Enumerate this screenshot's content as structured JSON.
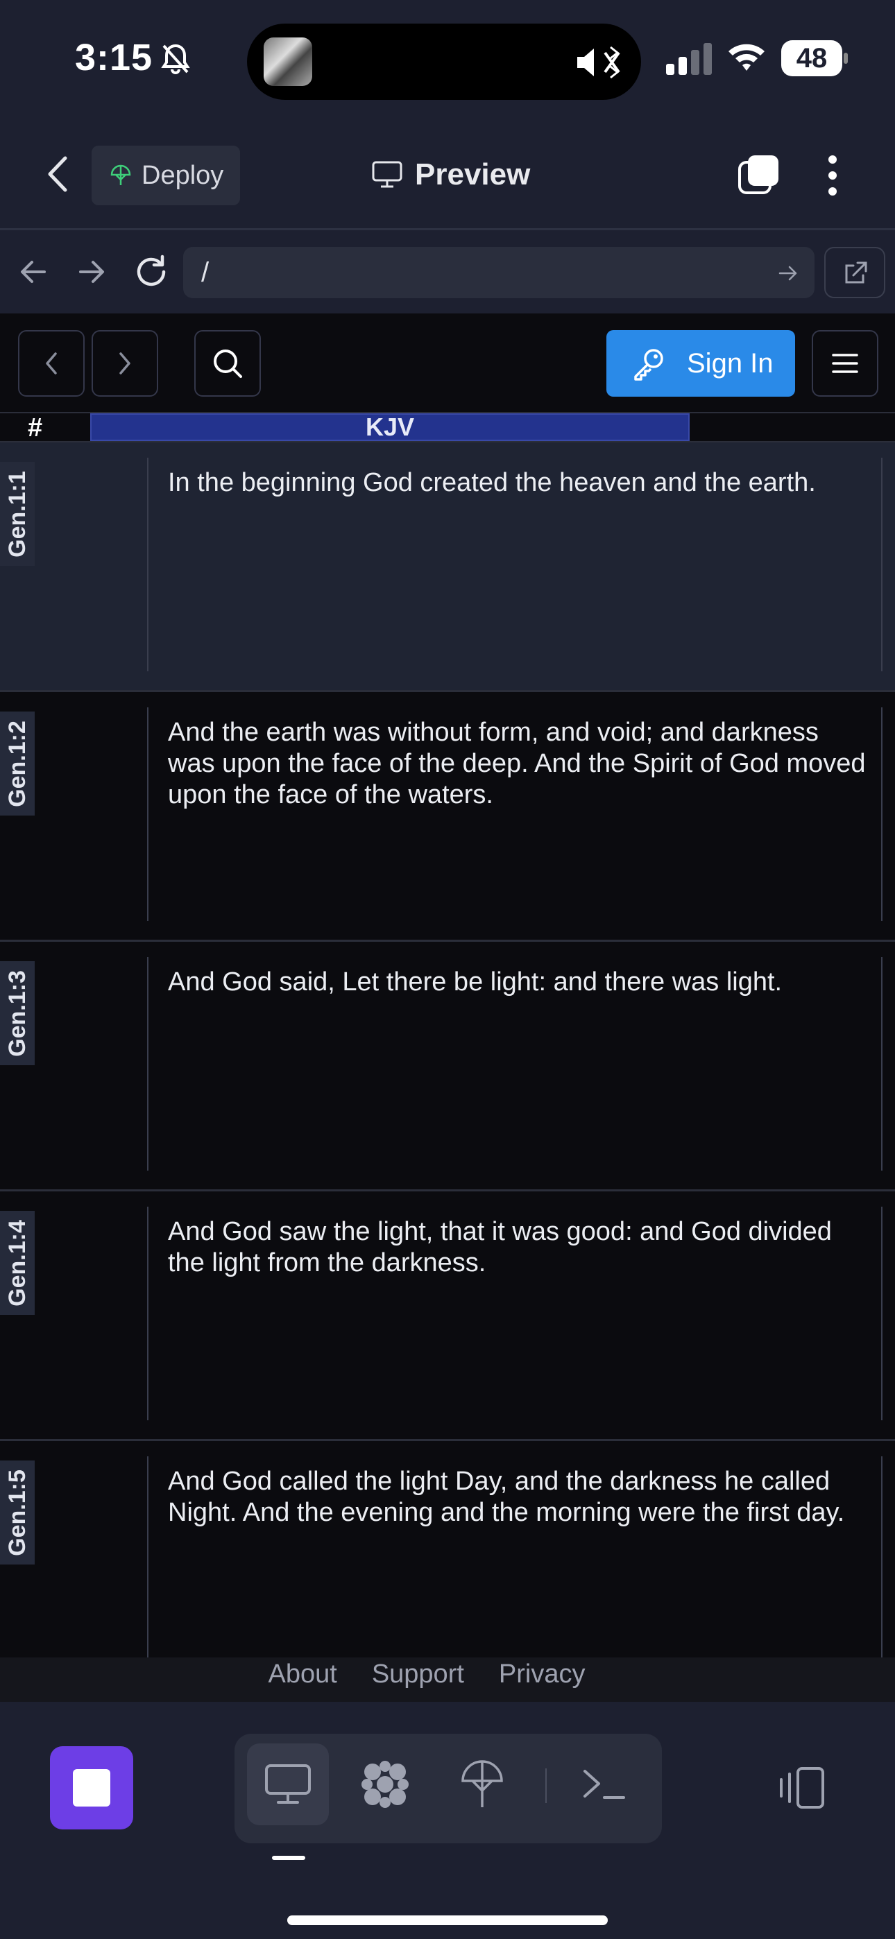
{
  "status_bar": {
    "time": "3:15",
    "battery": "48",
    "icons": [
      "bell-slash-icon",
      "speaker-mute-icon",
      "bluetooth-icon",
      "cellular-signal-icon",
      "wifi-icon",
      "battery-icon"
    ]
  },
  "header": {
    "deploy_label": "Deploy",
    "title": "Preview",
    "icons": [
      "back-chevron-icon",
      "deploy-umbrella-icon",
      "monitor-icon",
      "tabs-icon",
      "kebab-menu-icon"
    ]
  },
  "browser": {
    "url": "/",
    "icons": [
      "back-arrow-icon",
      "forward-arrow-icon",
      "reload-icon",
      "go-arrow-icon",
      "open-external-icon"
    ]
  },
  "site_nav": {
    "sign_in_label": "Sign In",
    "icons": [
      "chevron-left-icon",
      "chevron-right-icon",
      "search-icon",
      "key-icon",
      "hamburger-icon"
    ]
  },
  "table": {
    "ref_header": "#",
    "version_header": "KJV",
    "rows": [
      {
        "ref": "Gen.1:1",
        "text": "In the beginning God created the heaven and the earth."
      },
      {
        "ref": "Gen.1:2",
        "text": "And the earth was without form, and void; and darkness was upon the face of the deep. And the Spirit of God moved upon the face of the waters."
      },
      {
        "ref": "Gen.1:3",
        "text": "And God said, Let there be light: and there was light."
      },
      {
        "ref": "Gen.1:4",
        "text": "And God saw the light, that it was good: and God divided the light from the darkness."
      },
      {
        "ref": "Gen.1:5",
        "text": "And God called the light Day, and the darkness he called Night. And the evening and the morning were the first day."
      }
    ]
  },
  "footer": {
    "links": [
      "About",
      "Support",
      "Privacy"
    ]
  },
  "toolbar": {
    "icons": [
      "stop-icon",
      "desktop-icon",
      "flower-icon",
      "deploy-icon",
      "terminal-icon",
      "layout-toggle-icon"
    ]
  },
  "colors": {
    "accent_blue": "#2a8ae8",
    "stop_purple": "#6d3ee6",
    "kjv_header": "#23338e",
    "highlight_row": "#1f2433"
  }
}
